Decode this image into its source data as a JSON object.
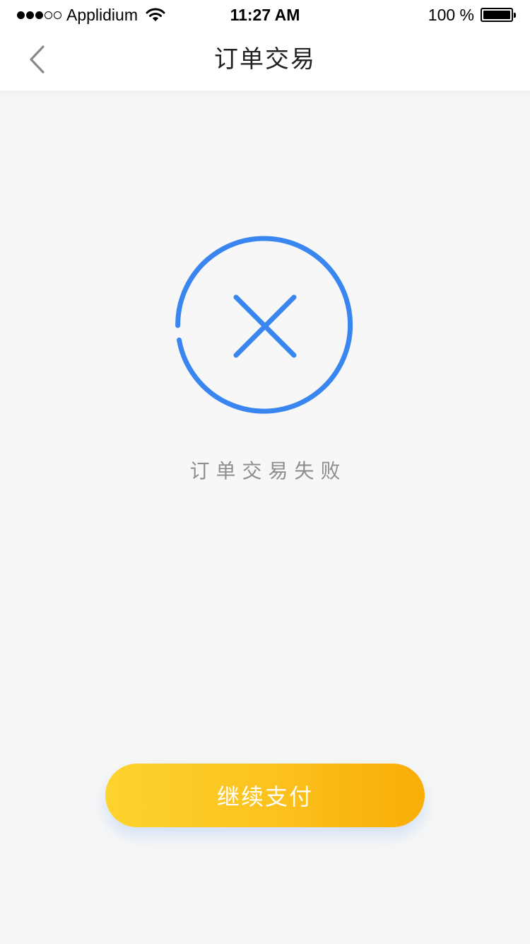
{
  "status_bar": {
    "carrier": "Applidium",
    "time": "11:27 AM",
    "battery_text": "100 %",
    "signal_filled_dots": 3,
    "signal_total_dots": 5,
    "battery_level": 1.0
  },
  "nav": {
    "title": "订单交易",
    "back_icon": "chevron-left-icon"
  },
  "result": {
    "icon": "fail-circle-x-icon",
    "message": "订单交易失败"
  },
  "actions": {
    "continue_label": "继续支付"
  },
  "colors": {
    "accent_blue": "#3a86f0",
    "button_gradient_start": "#fdd32d",
    "button_gradient_end": "#f9ad07",
    "background": "#f7f7f7",
    "secondary_text": "#8e8e8e"
  }
}
